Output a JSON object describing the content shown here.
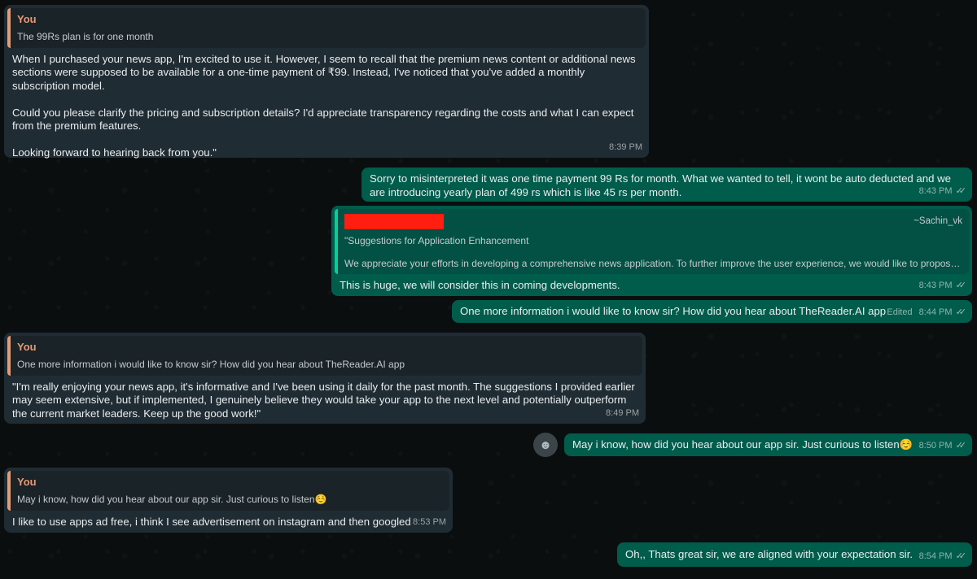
{
  "messages": [
    {
      "quote_name": "You",
      "quote_text": "The 99Rs plan is for one month",
      "text": "When I purchased your news app, I'm excited to use it. However, I seem to recall that the premium news content or additional news sections were supposed to be available for a one-time payment of ₹99. Instead, I've noticed that you've added a monthly subscription model.\n\nCould you please clarify the pricing and subscription details? I'd appreciate transparency regarding the costs and what I can expect from the premium features.\n\nLooking forward to hearing back from you.\"",
      "time": "8:39 PM"
    },
    {
      "text": "Sorry to misinterpreted it was one time payment 99 Rs for month. What we wanted to tell, it wont be auto deducted and we are introducing yearly plan of 499 rs which is like 45 rs per month.",
      "time": "8:43 PM"
    },
    {
      "quote_author": "~Sachin_vk",
      "quote_title": "\"Suggestions for Application Enhancement",
      "quote_text": "We appreciate your efforts in developing a comprehensive news application. To further improve the user experience, we would like to propos…",
      "text": "This is huge, we will consider this in coming developments.",
      "time": "8:43 PM"
    },
    {
      "text": "One more information i would like to know sir? How did you hear about TheReader.AI app",
      "edited": "Edited",
      "time": "8:44 PM"
    },
    {
      "quote_name": "You",
      "quote_text": "One more information i would like to know sir? How did you hear about TheReader.AI app",
      "text": "\"I'm really enjoying your news app, it's informative and I've been using it daily for the past month. The suggestions I provided earlier may seem extensive, but if implemented, I genuinely believe they would take your app to the next level and potentially outperform the current market leaders. Keep up the good work!\"",
      "time": "8:49 PM"
    },
    {
      "text": "May i know, how did you hear about our app sir. Just curious to listen☺️",
      "time": "8:50 PM"
    },
    {
      "quote_name": "You",
      "quote_text": "May i know, how did you hear about our app sir. Just curious to listen☺️",
      "text": "I like to use apps ad free, i think I see advertisement on instagram and then googled",
      "time": "8:53 PM"
    },
    {
      "text": "Oh,, Thats great sir, we are aligned with your expectation sir.",
      "time": "8:54 PM"
    }
  ],
  "icons": {
    "tick": "double-check-icon",
    "emoji": "emoji-react-icon"
  },
  "colors": {
    "incoming": "#202c33",
    "outgoing": "#005c4b",
    "quote_you": "#e79a75",
    "quote_self": "#06cf9c",
    "redaction": "#ff1e0f"
  }
}
